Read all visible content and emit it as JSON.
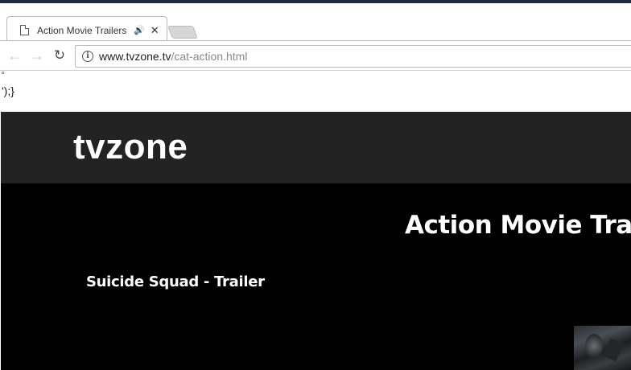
{
  "browser": {
    "tab": {
      "title": "Action Movie Trailers",
      "audio_icon": "🔊",
      "close_icon": "✕"
    },
    "toolbar": {
      "back_icon": "←",
      "forward_icon": "→",
      "reload_icon": "↻",
      "info_icon": "i",
      "url_host": "www.tvzone.tv",
      "url_path": "/cat-action.html"
    }
  },
  "page": {
    "stray_text": "');}",
    "logo": "tvzone",
    "page_title": "Action Movie Trail",
    "trailers": [
      {
        "title": "Suicide Squad - Trailer"
      }
    ]
  }
}
